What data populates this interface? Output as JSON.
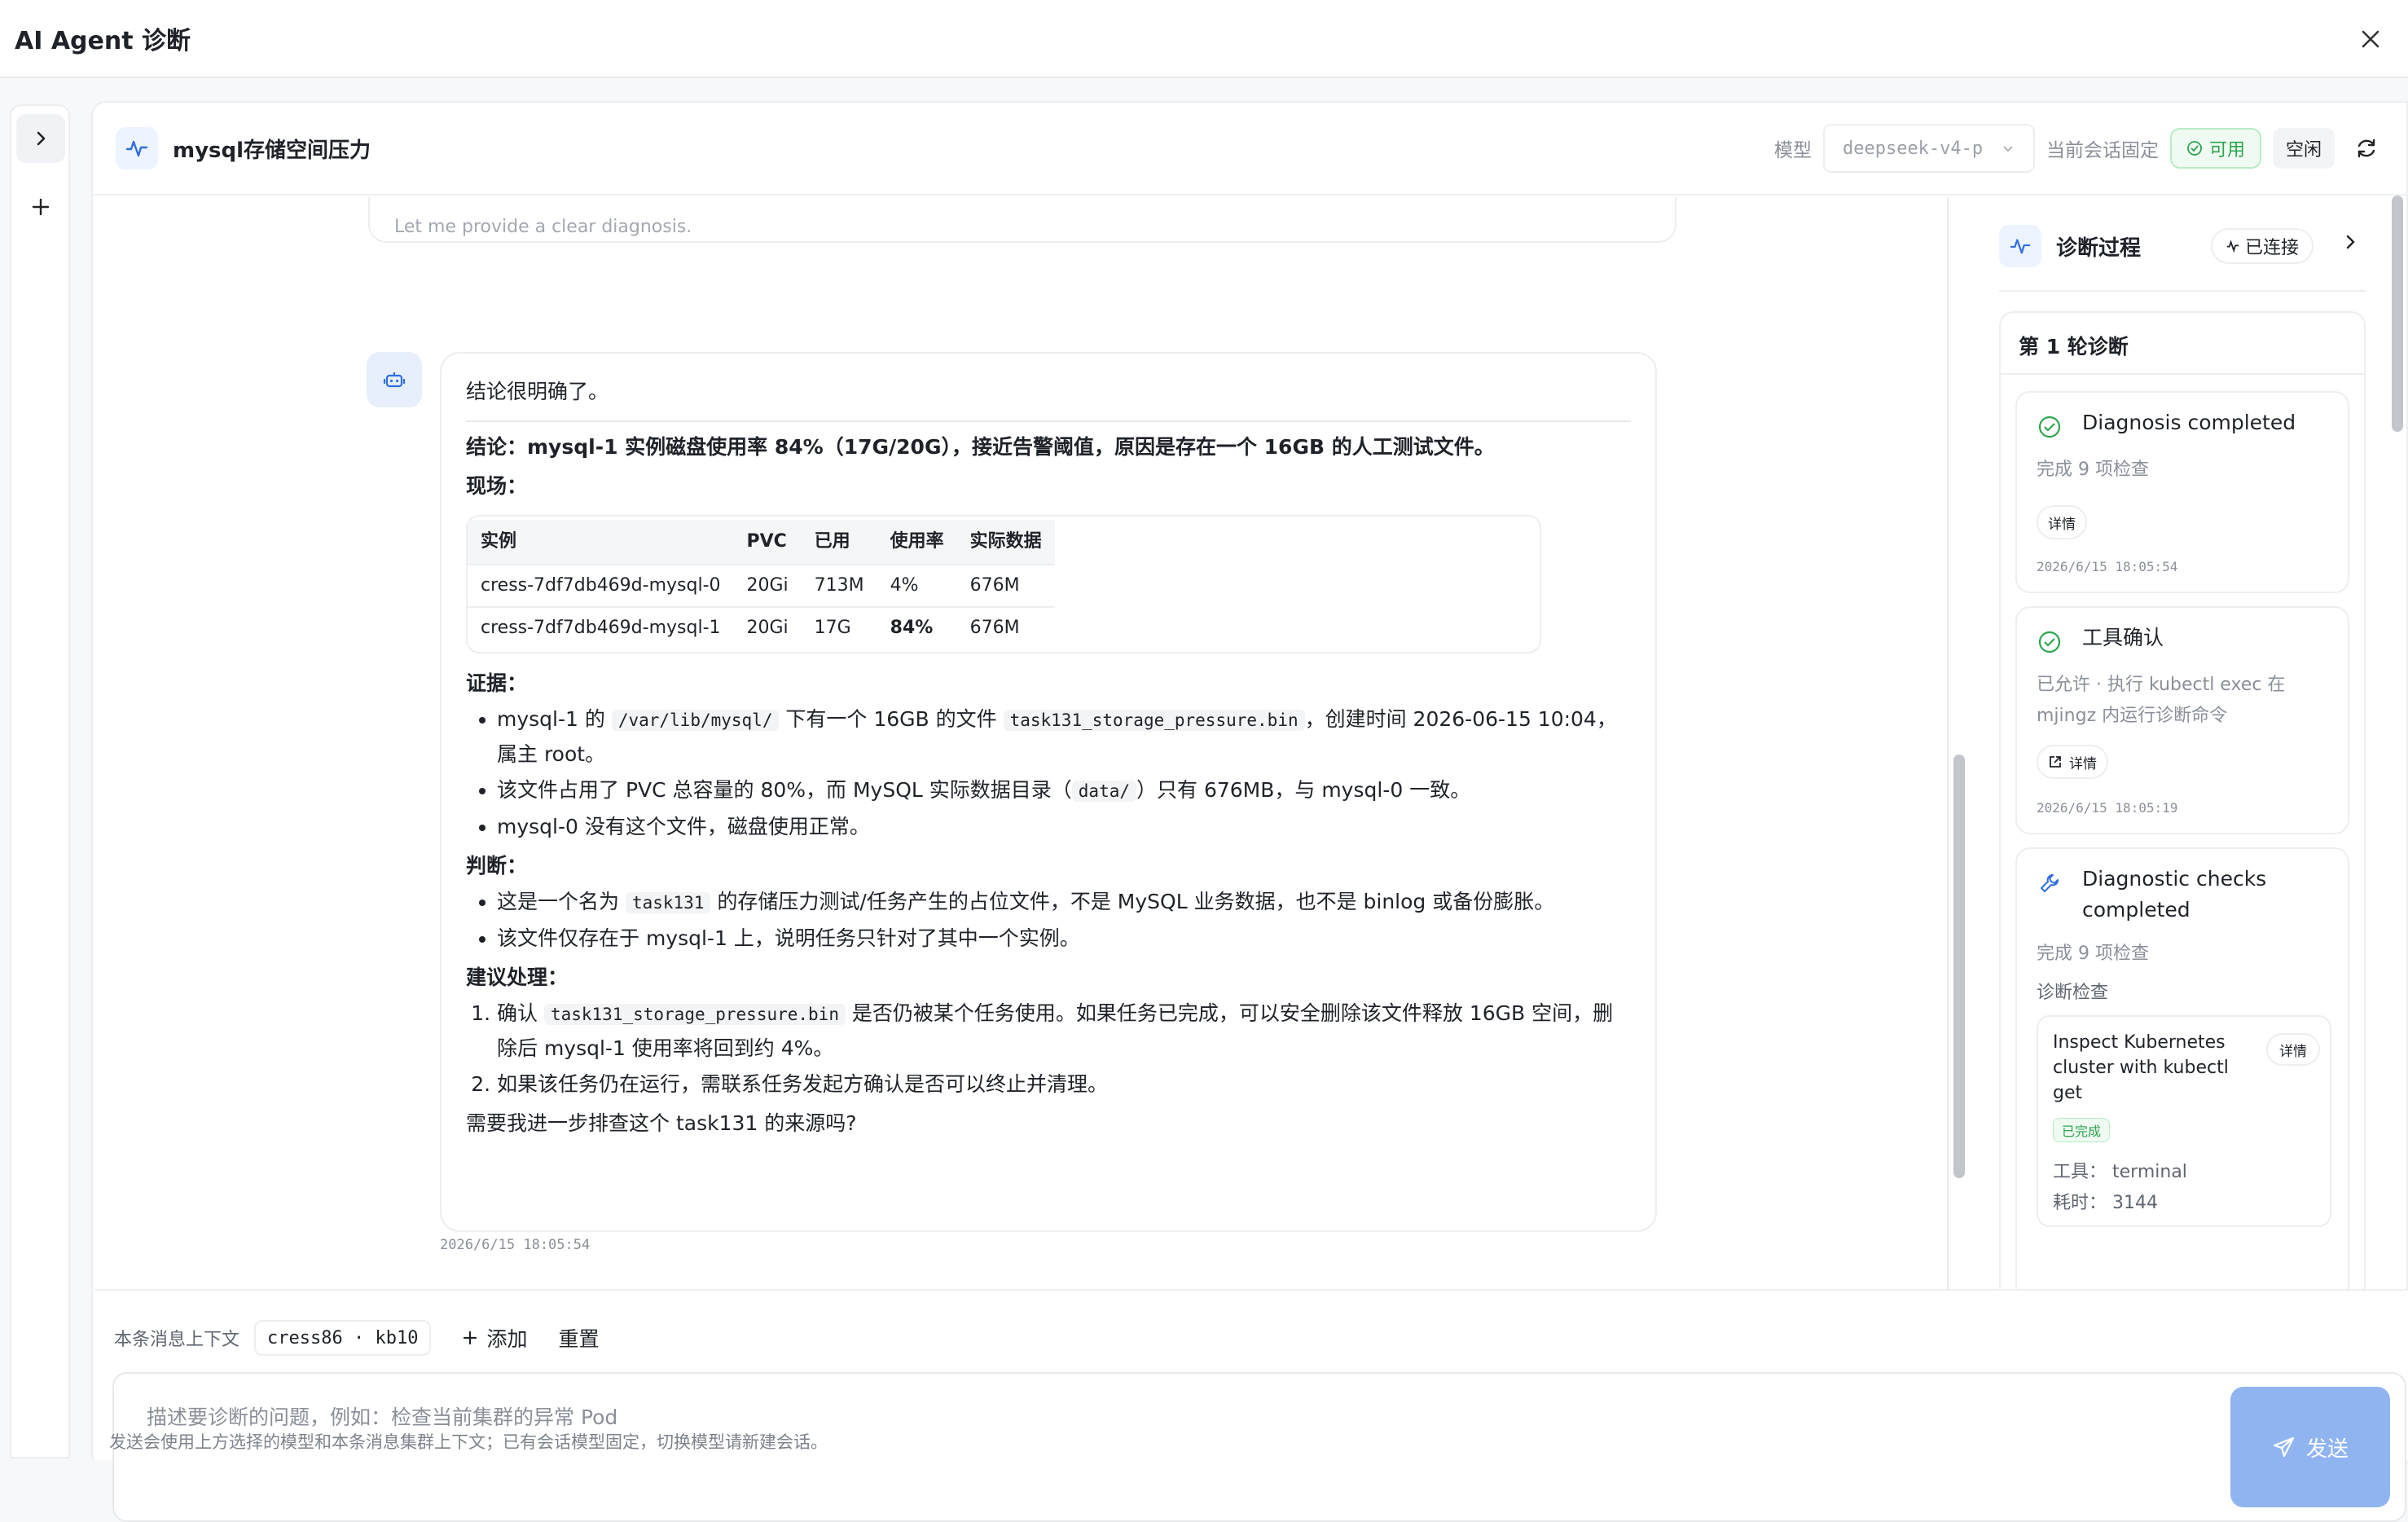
{
  "app": {
    "title": "AI Agent 诊断"
  },
  "rail": {
    "expand_icon": "chevron-right-icon",
    "new_icon": "plus-icon"
  },
  "header": {
    "title": "mysql存储空间压力",
    "model_label": "模型",
    "model_value": "deepseek-v4-p",
    "session_label": "当前会话固定",
    "status_ok": "可用",
    "status_idle": "空闲"
  },
  "previous_message": {
    "text": "Let me provide a clear diagnosis."
  },
  "message": {
    "intro": "结论很明确了。",
    "conclusion": "结论：mysql-1 实例磁盘使用率 84%（17G/20G），接近告警阈值，原因是存在一个 16GB 的人工测试文件。",
    "scene_heading": "现场：",
    "table": {
      "headers": [
        "实例",
        "PVC",
        "已用",
        "使用率",
        "实际数据"
      ],
      "rows": [
        [
          "cress-7df7db469d-mysql-0",
          "20Gi",
          "713M",
          "4%",
          "676M"
        ],
        [
          "cress-7df7db469d-mysql-1",
          "20Gi",
          "17G",
          "84%",
          "676M"
        ]
      ]
    },
    "evidence_heading": "证据：",
    "evidence": {
      "e1_a": "mysql-1 的 ",
      "e1_code1": "/var/lib/mysql/",
      "e1_b": " 下有一个 16GB 的文件 ",
      "e1_code2": "task131_storage_pressure.bin",
      "e1_c": "，创建时间 2026-06-15 10:04，属主 root。",
      "e2_a": "该文件占用了 PVC 总容量的 80%，而 MySQL 实际数据目录（",
      "e2_code": "data/",
      "e2_b": "）只有 676MB，与 mysql-0 一致。",
      "e3": "mysql-0 没有这个文件，磁盘使用正常。"
    },
    "judgement_heading": "判断：",
    "judgement": {
      "j1_a": "这是一个名为 ",
      "j1_code": "task131",
      "j1_b": " 的存储压力测试/任务产生的占位文件，不是 MySQL 业务数据，也不是 binlog 或备份膨胀。",
      "j2": "该文件仅存在于 mysql-1 上，说明任务只针对了其中一个实例。"
    },
    "advice_heading": "建议处理：",
    "advice": {
      "a1_a": "确认 ",
      "a1_code": "task131_storage_pressure.bin",
      "a1_b": " 是否仍被某个任务使用。如果任务已完成，可以安全删除该文件释放 16GB 空间，删除后 mysql-1 使用率将回到约 4%。",
      "a2": "如果该任务仍在运行，需联系任务发起方确认是否可以终止并清理。"
    },
    "closing": "需要我进一步排查这个 task131 的来源吗?",
    "timestamp": "2026/6/15 18:05:54"
  },
  "diagnosis_panel": {
    "title": "诊断过程",
    "connection": "已连接",
    "round_title": "第 1 轮诊断",
    "cards": [
      {
        "title": "Diagnosis completed",
        "subtitle": "完成 9 项检查",
        "button": "详情",
        "timestamp": "2026/6/15 18:05:54",
        "icon": "check-circle-icon"
      },
      {
        "title": "工具确认",
        "subtitle": "已允许 · 执行 kubectl exec 在 mjingz 内运行诊断命令",
        "button": "详情",
        "timestamp": "2026/6/15 18:05:19",
        "icon": "check-circle-icon"
      },
      {
        "title": "Diagnostic checks completed",
        "subtitle": "完成 9 项检查",
        "section": "诊断检查",
        "icon": "wrench-icon"
      }
    ],
    "check": {
      "title": "Inspect Kubernetes cluster with kubectl get",
      "button": "详情",
      "status": "已完成",
      "tool_label": "工具：",
      "tool_value": "terminal",
      "duration_label": "耗时：",
      "duration_value": "3144"
    }
  },
  "composer": {
    "context_label": "本条消息上下文",
    "context_chip": "cress86 · kb10",
    "add_label": "添加",
    "reset_label": "重置",
    "placeholder": "描述要诊断的问题，例如：检查当前集群的异常 Pod",
    "send_label": "发送",
    "hint": "发送会使用上方选择的模型和本条消息集群上下文；已有会话模型固定，切换模型请新建会话。"
  },
  "colors": {
    "accent": "#2f6fe0",
    "success": "#2ea44f",
    "send_button": "#8fb4f0"
  }
}
